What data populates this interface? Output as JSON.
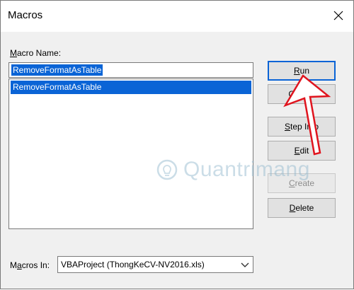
{
  "window": {
    "title": "Macros",
    "close_label": "×"
  },
  "macro_name": {
    "label_prefix": "",
    "label_accel": "M",
    "label_rest": "acro Name:",
    "value": "RemoveFormatAsTable"
  },
  "macro_list": {
    "items": [
      "RemoveFormatAsTable"
    ],
    "selected_index": 0
  },
  "buttons": {
    "run": {
      "pre": "",
      "accel": "R",
      "post": "un",
      "enabled": true
    },
    "cancel": {
      "pre": "Cancel",
      "accel": "",
      "post": "",
      "enabled": true
    },
    "step_into": {
      "pre": "",
      "accel": "S",
      "post": "tep Into",
      "enabled": true
    },
    "edit": {
      "pre": "",
      "accel": "E",
      "post": "dit",
      "enabled": true
    },
    "create": {
      "pre": "",
      "accel": "C",
      "post": "reate",
      "enabled": false
    },
    "delete": {
      "pre": "",
      "accel": "D",
      "post": "elete",
      "enabled": true
    }
  },
  "macros_in": {
    "label_prefix": "M",
    "label_accel": "a",
    "label_rest": "cros In:",
    "value": "VBAProject (ThongKeCV-NV2016.xls)"
  },
  "watermark": {
    "text": "Quantrimang"
  },
  "colors": {
    "selection": "#0a64d6",
    "annotation_arrow": "#e0141e",
    "dialog_bg": "#f0f0f0"
  }
}
